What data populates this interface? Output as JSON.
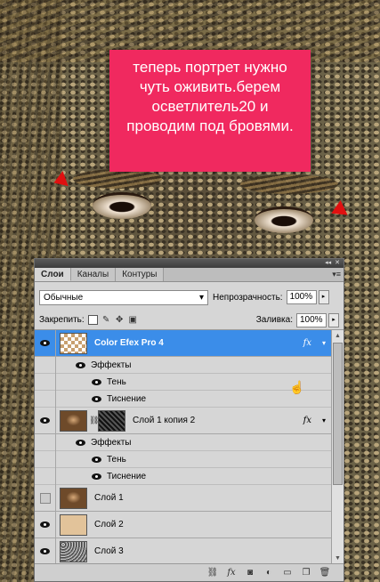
{
  "annotation": {
    "text": "теперь портрет нужно чуть оживить.берем осветлитель20 и проводим под бровями."
  },
  "colors": {
    "note_bg": "#f0295f",
    "selected_layer": "#3b8de9",
    "arrow": "#e01010"
  },
  "panel": {
    "tabs": [
      "Слои",
      "Каналы",
      "Контуры"
    ],
    "blend_mode": "Обычные",
    "opacity_label": "Непрозрачность:",
    "opacity_value": "100%",
    "lock_label": "Закрепить:",
    "fill_label": "Заливка:",
    "fill_value": "100%"
  },
  "layers": [
    {
      "name": "Color Efex Pro 4",
      "visible": true,
      "selected": true,
      "fx": "fx"
    },
    {
      "name": "Слой 1 копия 2",
      "visible": true,
      "selected": false,
      "fx": "fx"
    },
    {
      "name": "Слой 1",
      "visible": false
    },
    {
      "name": "Слой 2",
      "visible": true
    },
    {
      "name": "Слой 3",
      "visible": true
    }
  ],
  "effects": {
    "group_label": "Эффекты",
    "shadow": "Тень",
    "emboss": "Тиснение"
  },
  "icons": {
    "eye": "eye-icon",
    "link": "link-icon",
    "fx": "fx-icon",
    "mask": "add-mask-icon",
    "adjustment": "adjustment-icon",
    "folder": "new-group-icon",
    "new_layer": "new-layer-icon",
    "trash": "trash-icon"
  }
}
